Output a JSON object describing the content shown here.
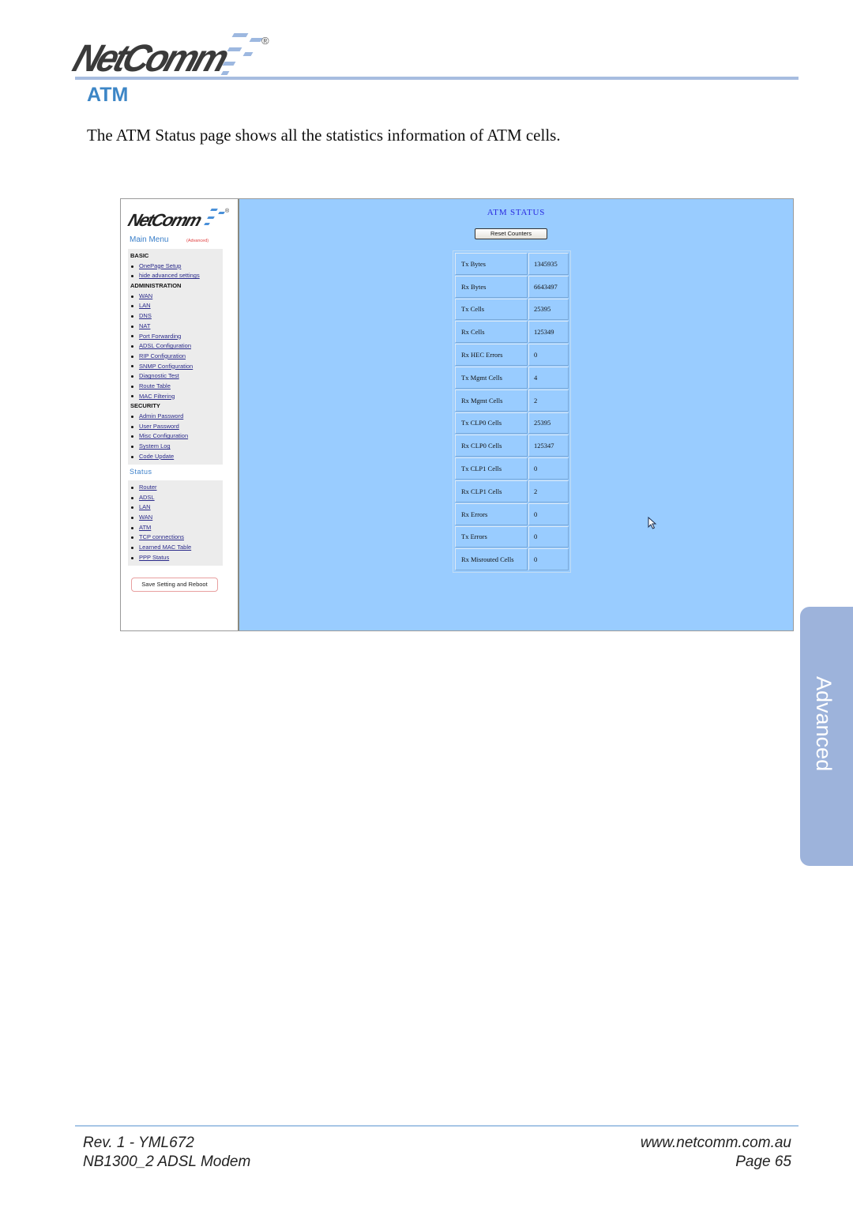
{
  "header": {
    "logo_text": "NetComm",
    "registered_mark": "®",
    "section_title": "ATM",
    "intro": "The ATM Status page shows all the statistics information of ATM cells."
  },
  "screenshot": {
    "logo_text": "NetComm",
    "registered_mark": "®",
    "menu_title": "Main Menu",
    "menu_mode": "(Advanced)",
    "groups": [
      {
        "title": "BASIC",
        "items": [
          "OnePage Setup",
          "hide advanced settings"
        ]
      },
      {
        "title": "ADMINISTRATION",
        "items": [
          "WAN",
          "LAN",
          "DNS",
          "NAT",
          "Port Forwarding",
          "ADSL Configuration",
          "RIP Configuration",
          "SNMP Configuration",
          "Diagnostic Test",
          "Route Table",
          "MAC Filtering"
        ]
      },
      {
        "title": "SECURITY",
        "items": [
          "Admin Password",
          "User Password",
          "Misc Configuration",
          "System Log",
          "Code Update"
        ]
      }
    ],
    "status_title": "Status",
    "status_items": [
      "Router",
      "ADSL",
      "LAN",
      "WAN",
      "ATM",
      "TCP connections",
      "Learned MAC Table",
      "PPP Status"
    ],
    "save_button": "Save Setting and Reboot",
    "page_title": "ATM STATUS",
    "reset_button": "Reset Counters",
    "stats": [
      {
        "label": "Tx Bytes",
        "value": "1345935"
      },
      {
        "label": "Rx Bytes",
        "value": "6643497"
      },
      {
        "label": "Tx Cells",
        "value": "25395"
      },
      {
        "label": "Rx Cells",
        "value": "125349"
      },
      {
        "label": "Rx HEC Errors",
        "value": "0"
      },
      {
        "label": "Tx Mgmt Cells",
        "value": "4"
      },
      {
        "label": "Rx Mgmt Cells",
        "value": "2"
      },
      {
        "label": "Tx CLP0 Cells",
        "value": "25395"
      },
      {
        "label": "Rx CLP0 Cells",
        "value": "125347"
      },
      {
        "label": "Tx CLP1 Cells",
        "value": "0"
      },
      {
        "label": "Rx CLP1 Cells",
        "value": "2"
      },
      {
        "label": "Rx Errors",
        "value": "0"
      },
      {
        "label": "Tx Errors",
        "value": "0"
      },
      {
        "label": "Rx Misrouted Cells",
        "value": "0"
      }
    ]
  },
  "side_tab": {
    "label": "Advanced"
  },
  "footer": {
    "revision": "Rev. 1 - YML672",
    "product": "NB1300_2  ADSL Modem",
    "website": "www.netcomm.com.au",
    "page": "Page 65"
  },
  "colors": {
    "accent": "#3d86c6",
    "rule": "#a7bde0",
    "panel_bg": "#99ccff",
    "side_tab": "#9db3db"
  }
}
